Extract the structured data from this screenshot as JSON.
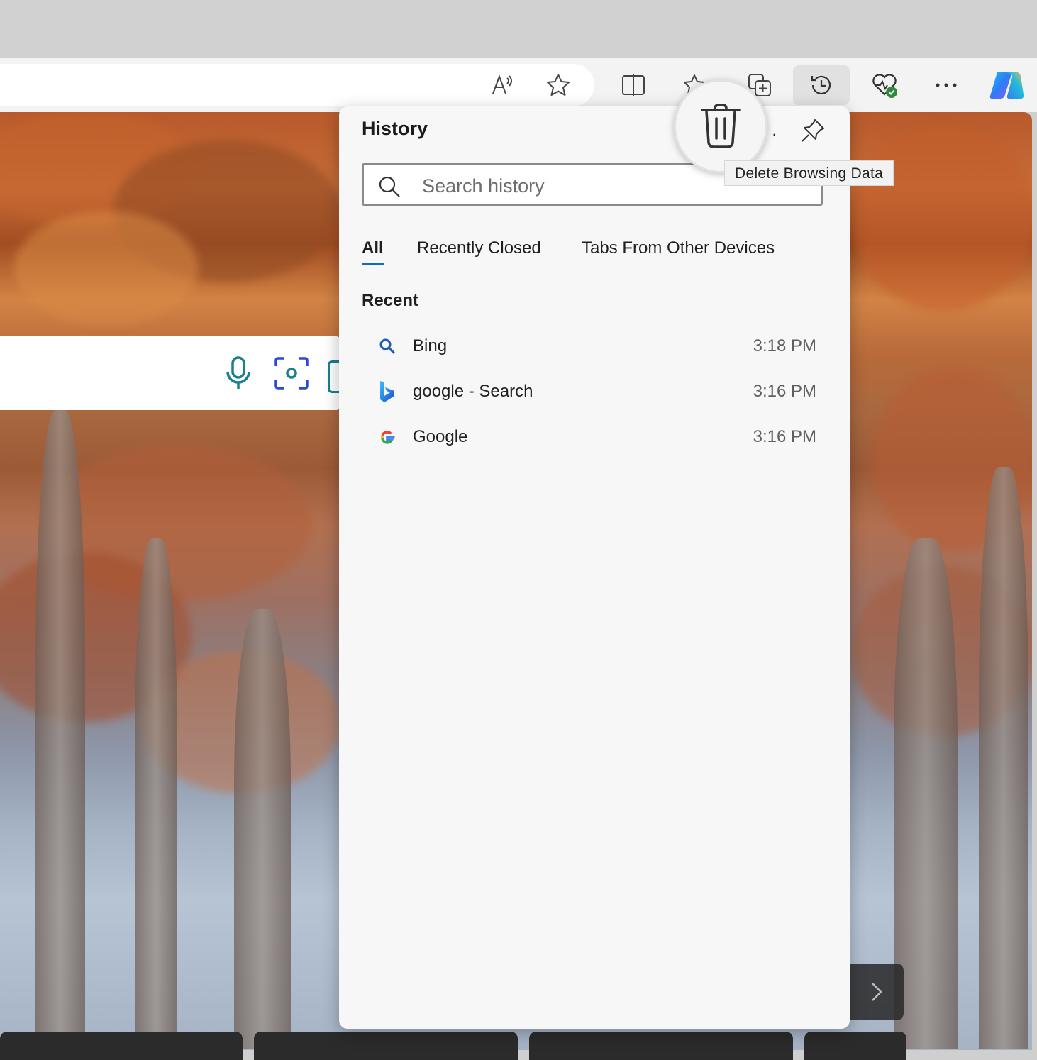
{
  "toolbar": {
    "icons": [
      "read-aloud-icon",
      "favorite-star-icon",
      "split-screen-icon",
      "favorites-icon",
      "collections-icon",
      "history-icon",
      "browser-essentials-icon",
      "more-icon",
      "copilot-icon"
    ]
  },
  "history": {
    "title": "History",
    "search_placeholder": "Search history",
    "tabs": [
      {
        "label": "All",
        "active": true
      },
      {
        "label": "Recently Closed",
        "active": false
      },
      {
        "label": "Tabs From Other Devices",
        "active": false
      }
    ],
    "recent_heading": "Recent",
    "items": [
      {
        "title": "Bing",
        "time": "3:18 PM",
        "icon": "search-icon"
      },
      {
        "title": "google - Search",
        "time": "3:16 PM",
        "icon": "bing-icon"
      },
      {
        "title": "Google",
        "time": "3:16 PM",
        "icon": "google-icon"
      }
    ]
  },
  "tooltip": {
    "text": "Delete Browsing Data"
  },
  "colors": {
    "accent": "#0f6cbd",
    "panel_bg": "#f7f7f7",
    "chrome_bg": "#f3f3f3"
  }
}
